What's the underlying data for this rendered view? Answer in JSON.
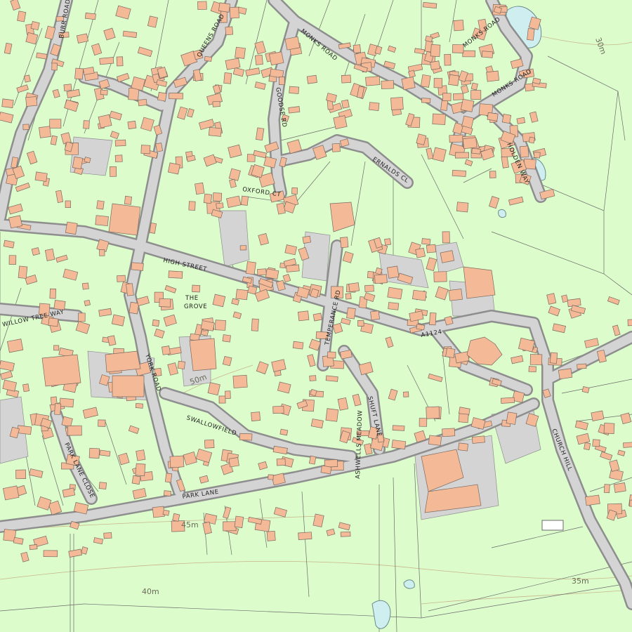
{
  "map": {
    "colors": {
      "land": "#dcfdcb",
      "building": "#f4b996",
      "road": "#d4d4d4",
      "road_edge": "#8e8e8e",
      "water": "#cfeef0",
      "contour": "#c9b48b"
    },
    "road_labels": {
      "burr_road": "BURR ROAD",
      "queens_road": "QUEENS ROAD",
      "monks_road_north": "MONKS ROAD",
      "monks_road_ne": "MONKS ROAD",
      "monks_road_e": "MONKS ROAD",
      "goodse_rd": "GOODSE RD",
      "oxford_ct": "OXFORD CT",
      "erwalds_cl": "ERNALDS CL",
      "holden_way": "HOLDEN WAY",
      "high_street": "HIGH STREET",
      "the": "THE",
      "grove": "GROVE",
      "temperance_rd": "TEMPERANCE RD",
      "a1124": "A1124",
      "willow_tree_way": "WILLOW TREE WAY",
      "york_road": "YORK ROAD",
      "swallowfield": "SWALLOWFIELD",
      "shuff_lane": "SHUFT LANE",
      "ashwells_meadow": "ASHWELLS MEADOW",
      "church_hill": "CHURCH HILL",
      "park_lane_close": "PARK LANE CLOSE",
      "park_lane": "PARK LANE"
    },
    "contour_labels": {
      "c30": "30m",
      "c35": "35m",
      "c40": "40m",
      "c45": "45m",
      "c50": "50m"
    }
  }
}
